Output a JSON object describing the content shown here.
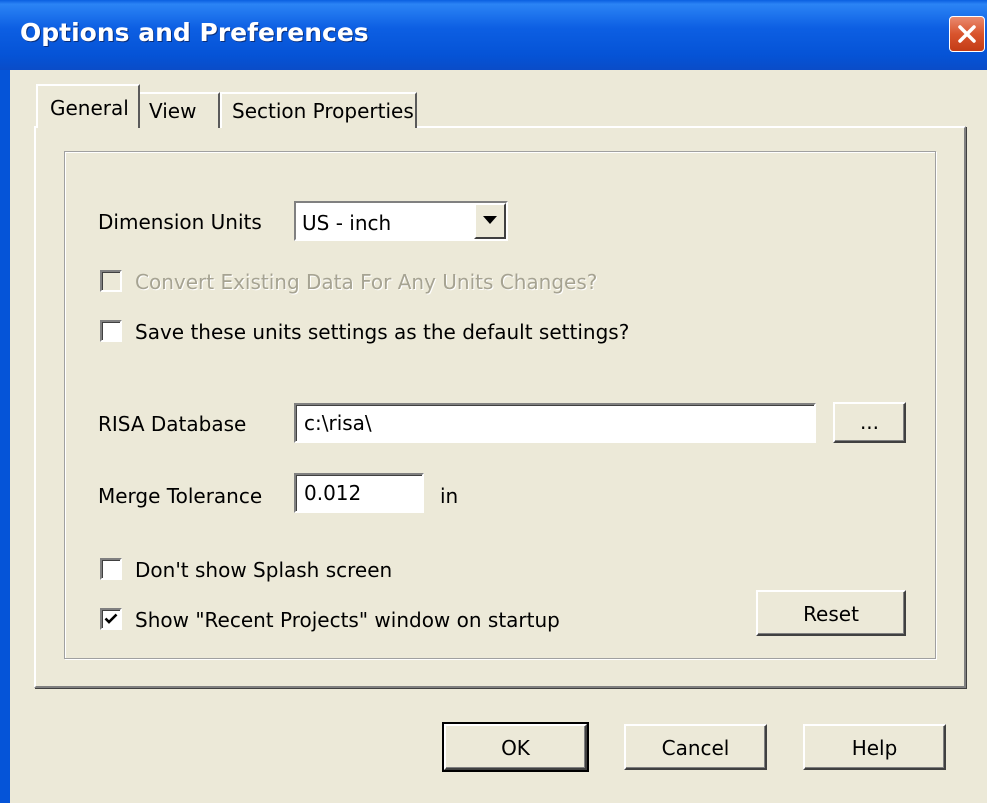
{
  "window": {
    "title": "Options and Preferences"
  },
  "tabs": [
    {
      "label": "General",
      "active": true
    },
    {
      "label": "View",
      "active": false
    },
    {
      "label": "Section Properties",
      "active": false
    }
  ],
  "general": {
    "dimension_units": {
      "label": "Dimension Units",
      "selected": "US - inch"
    },
    "convert_existing": {
      "label": "Convert Existing Data For Any Units Changes?",
      "checked": false,
      "enabled": false
    },
    "save_default": {
      "label": "Save these units settings as the default settings?",
      "checked": false
    },
    "risa_database": {
      "label": "RISA Database",
      "value": "c:\\risa\\",
      "browse_label": "..."
    },
    "merge_tolerance": {
      "label": "Merge Tolerance",
      "value": "0.012",
      "unit": "in"
    },
    "no_splash": {
      "label": "Don't show Splash screen",
      "checked": false
    },
    "recent_projects": {
      "label": "Show \"Recent Projects\" window on startup",
      "checked": true
    },
    "reset_label": "Reset"
  },
  "footer": {
    "ok_label": "OK",
    "cancel_label": "Cancel",
    "help_label": "Help"
  },
  "colors": {
    "titlebar": "#0553d6",
    "dialog_bg": "#ece9d8",
    "close_button": "#d9542d"
  },
  "icons": {
    "close": "close-icon",
    "dropdown": "dropdown-arrow-icon",
    "check": "checkmark-icon"
  }
}
